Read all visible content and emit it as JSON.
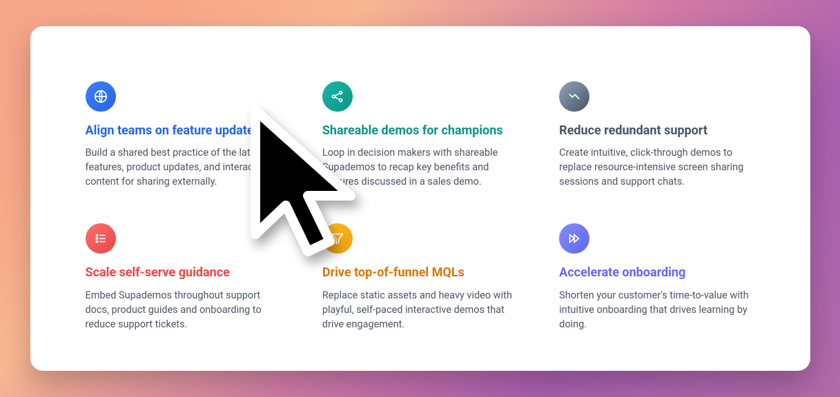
{
  "features": [
    {
      "title": "Align teams on feature updates",
      "desc": "Build a shared best practice of the latest features, product updates, and interactive content for sharing externally.",
      "titleColor": "c-blue",
      "badge": "grad-blue",
      "icon": "globe"
    },
    {
      "title": "Shareable demos for champions",
      "desc": "Loop in decision makers with shareable Supademos to recap key benefits and features discussed in a sales demo.",
      "titleColor": "c-teal",
      "badge": "grad-teal",
      "icon": "share"
    },
    {
      "title": "Reduce redundant support",
      "desc": "Create intuitive, click-through demos to replace resource-intensive screen sharing sessions and support chats.",
      "titleColor": "c-slate",
      "badge": "grad-slate",
      "icon": "trend"
    },
    {
      "title": "Scale self-serve guidance",
      "desc": "Embed Supademos throughout support docs, product guides and onboarding to reduce support tickets.",
      "titleColor": "c-red",
      "badge": "grad-red",
      "icon": "list"
    },
    {
      "title": "Drive top-of-funnel MQLs",
      "desc": "Replace static assets and heavy video with playful, self-paced interactive demos that drive engagement.",
      "titleColor": "c-amber",
      "badge": "grad-amber",
      "icon": "filter"
    },
    {
      "title": "Accelerate onboarding",
      "desc": "Shorten your customer's time-to-value with intuitive onboarding that drives learning by doing.",
      "titleColor": "c-indigo",
      "badge": "grad-indigo",
      "icon": "forward"
    }
  ]
}
